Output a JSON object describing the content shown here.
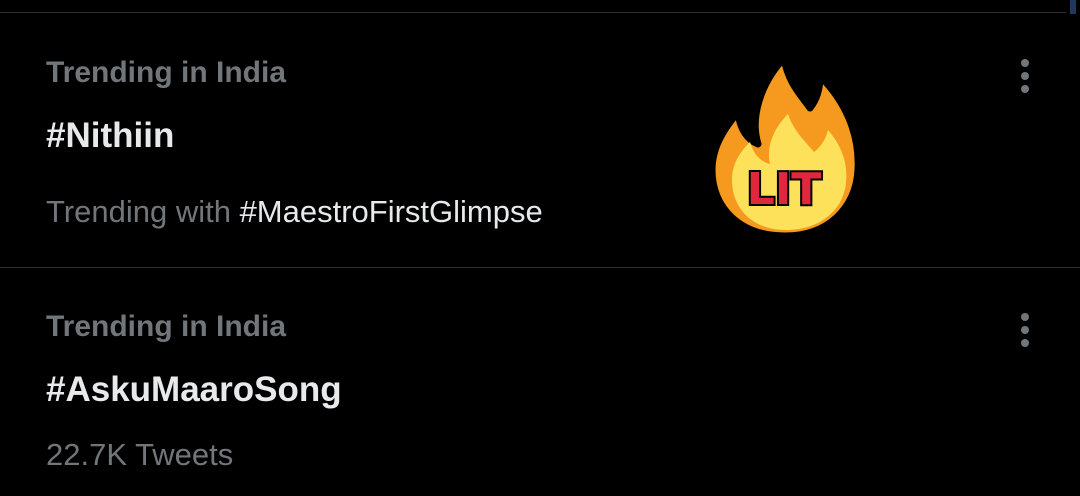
{
  "colors": {
    "background": "#000000",
    "primary_text": "#e7e9ea",
    "secondary_text": "#71767b",
    "divider": "#2f3336"
  },
  "trends": [
    {
      "context": "Trending in India",
      "hashtag": "#Nithiin",
      "subline_prefix": "Trending with ",
      "subline_tag": "#MaestroFirstGlimpse",
      "sticker_text": "LIT",
      "sticker_icon": "fire-lit-icon"
    },
    {
      "context": "Trending in India",
      "hashtag": "#AskuMaaroSong",
      "tweet_count": "22.7K Tweets"
    }
  ],
  "icons": {
    "more": "more-vertical-icon"
  }
}
